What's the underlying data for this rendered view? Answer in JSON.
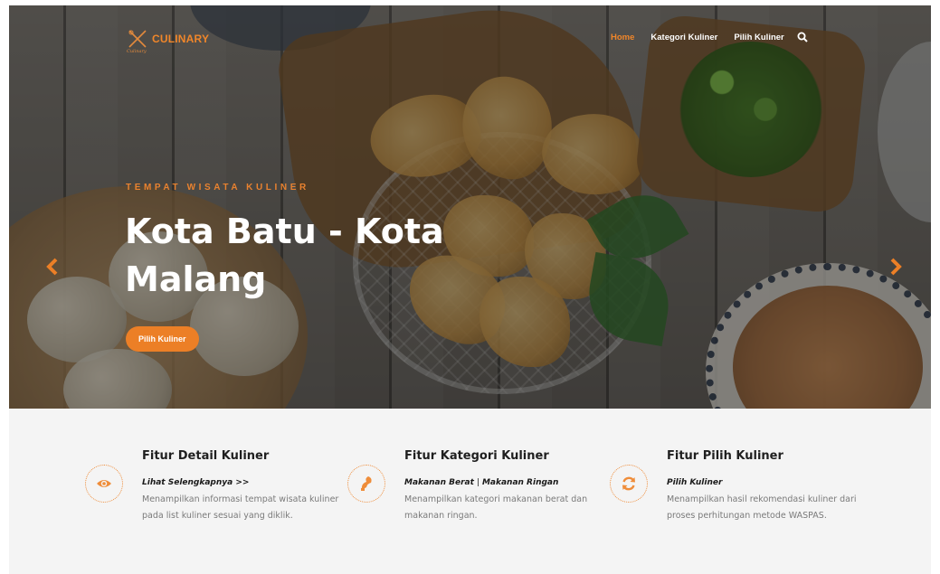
{
  "brand": {
    "name": "CULINARY",
    "tagline": "Culinary",
    "accent_color": "#ec7f26",
    "logo_icon": "crossed-utensils-icon"
  },
  "nav": {
    "items": [
      {
        "label": "Home",
        "active": true
      },
      {
        "label": "Kategori Kuliner",
        "active": false
      },
      {
        "label": "Pilih Kuliner",
        "active": false
      }
    ],
    "search_icon": "search-icon"
  },
  "hero": {
    "eyebrow": "TEMPAT WISATA KULINER",
    "headline": "Kota Batu - Kota Malang",
    "cta_label": "Pilih Kuliner",
    "prev_icon": "chevron-left-icon",
    "next_icon": "chevron-right-icon"
  },
  "features": [
    {
      "title": "Fitur Detail Kuliner",
      "icon": "eye-icon",
      "link_label": "Lihat Selengkapnya >>",
      "description": "Menampilkan informasi tempat wisata kuliner pada list kuliner sesuai yang diklik."
    },
    {
      "title": "Fitur Kategori Kuliner",
      "icon": "food-category-icon",
      "link_a": "Makanan Berat",
      "separator": "|",
      "link_b": "Makanan Ringan",
      "description": "Menampilkan kategori makanan berat dan makanan ringan."
    },
    {
      "title": "Fitur Pilih Kuliner",
      "icon": "refresh-icon",
      "link_label": "Pilih Kuliner",
      "description": "Menampilkan hasil rekomendasi kuliner dari proses perhitungan metode WASPAS."
    }
  ]
}
